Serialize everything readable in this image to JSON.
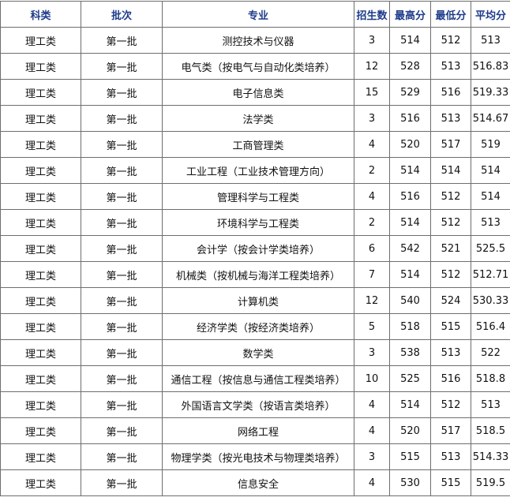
{
  "headers": [
    "科类",
    "批次",
    "专业",
    "招生数",
    "最高分",
    "最低分",
    "平均分"
  ],
  "rows": [
    [
      "理工类",
      "第一批",
      "测控技术与仪器",
      "3",
      "514",
      "512",
      "513"
    ],
    [
      "理工类",
      "第一批",
      "电气类（按电气与自动化类培养）",
      "12",
      "528",
      "513",
      "516.83"
    ],
    [
      "理工类",
      "第一批",
      "电子信息类",
      "15",
      "529",
      "516",
      "519.33"
    ],
    [
      "理工类",
      "第一批",
      "法学类",
      "3",
      "516",
      "513",
      "514.67"
    ],
    [
      "理工类",
      "第一批",
      "工商管理类",
      "4",
      "520",
      "517",
      "519"
    ],
    [
      "理工类",
      "第一批",
      "工业工程（工业技术管理方向）",
      "2",
      "514",
      "514",
      "514"
    ],
    [
      "理工类",
      "第一批",
      "管理科学与工程类",
      "4",
      "516",
      "512",
      "514"
    ],
    [
      "理工类",
      "第一批",
      "环境科学与工程类",
      "2",
      "514",
      "512",
      "513"
    ],
    [
      "理工类",
      "第一批",
      "会计学（按会计学类培养）",
      "6",
      "542",
      "521",
      "525.5"
    ],
    [
      "理工类",
      "第一批",
      "机械类（按机械与海洋工程类培养）",
      "7",
      "514",
      "512",
      "512.71"
    ],
    [
      "理工类",
      "第一批",
      "计算机类",
      "12",
      "540",
      "524",
      "530.33"
    ],
    [
      "理工类",
      "第一批",
      "经济学类（按经济类培养）",
      "5",
      "518",
      "515",
      "516.4"
    ],
    [
      "理工类",
      "第一批",
      "数学类",
      "3",
      "538",
      "513",
      "522"
    ],
    [
      "理工类",
      "第一批",
      "通信工程（按信息与通信工程类培养）",
      "10",
      "525",
      "516",
      "518.8"
    ],
    [
      "理工类",
      "第一批",
      "外国语言文学类（按语言类培养）",
      "4",
      "514",
      "512",
      "513"
    ],
    [
      "理工类",
      "第一批",
      "网络工程",
      "4",
      "520",
      "517",
      "518.5"
    ],
    [
      "理工类",
      "第一批",
      "物理学类（按光电技术与物理类培养）",
      "3",
      "515",
      "513",
      "514.33"
    ],
    [
      "理工类",
      "第一批",
      "信息安全",
      "4",
      "530",
      "515",
      "519.5"
    ]
  ]
}
